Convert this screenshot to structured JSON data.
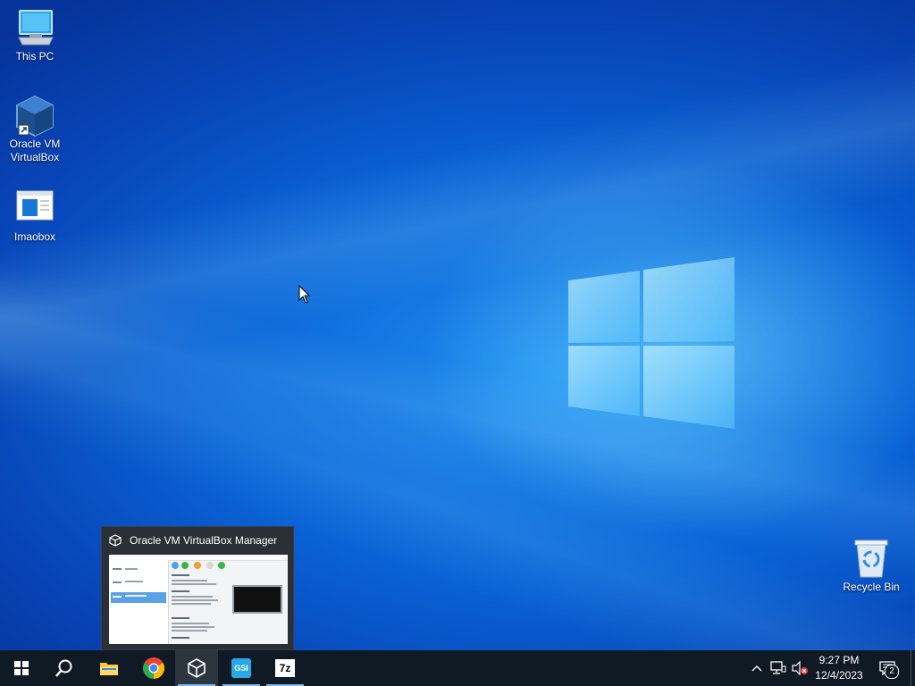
{
  "desktop": {
    "icons": [
      {
        "label": "This PC",
        "icon": "computer-icon"
      },
      {
        "label": "Oracle VM VirtualBox",
        "icon": "virtualbox-icon"
      },
      {
        "label": "Imaobox",
        "icon": "app-window-icon"
      },
      {
        "label": "Recycle Bin",
        "icon": "recycle-bin-icon"
      }
    ]
  },
  "thumbnail": {
    "title": "Oracle VM VirtualBox Manager",
    "icon": "virtualbox-icon"
  },
  "taskbar": {
    "buttons": [
      {
        "name": "start",
        "icon": "windows-start-icon",
        "active": false
      },
      {
        "name": "search",
        "icon": "search-icon",
        "active": false
      },
      {
        "name": "file-explorer",
        "icon": "folder-icon",
        "active": false
      },
      {
        "name": "chrome",
        "icon": "chrome-icon",
        "active": false
      },
      {
        "name": "virtualbox",
        "icon": "virtualbox-icon",
        "active": true
      },
      {
        "name": "gsi",
        "icon": "gsi-app-icon",
        "active": false
      },
      {
        "name": "7zip",
        "icon": "7zip-icon",
        "active": false
      }
    ],
    "gsi_label": "GSI",
    "sevenzip_label": "7z"
  },
  "tray": {
    "time": "9:27 PM",
    "date": "12/4/2023",
    "notification_count": "2",
    "icons": [
      "chevron-up-icon",
      "network-icon",
      "volume-muted-icon",
      "action-center-icon"
    ]
  },
  "colors": {
    "taskbar_bg": "#101a24",
    "desktop_accent": "#0a63d6",
    "active_underline": "#79b8f0"
  }
}
